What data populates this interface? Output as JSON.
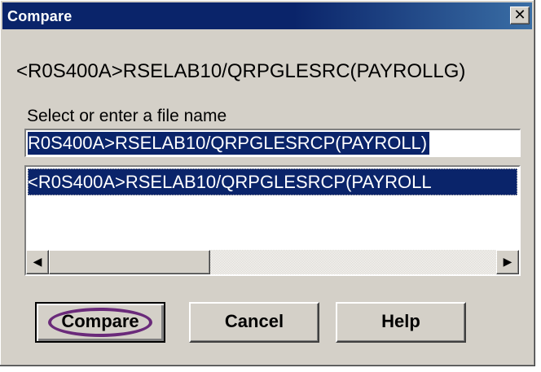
{
  "window": {
    "title": "Compare",
    "close_glyph": "✕"
  },
  "member_path": "<R0S400A>RSELAB10/QRPGLESRC(PAYROLLG)",
  "file_select": {
    "label": "Select or enter a file name",
    "input_value": "R0S400A>RSELAB10/QRPGLESRCP(PAYROLL)",
    "list_items": [
      "<R0S400A>RSELAB10/QRPGLESRCP(PAYROLL"
    ],
    "selected_index": 0
  },
  "scrollbar": {
    "left_arrow": "◀",
    "right_arrow": "▶"
  },
  "buttons": {
    "compare": "Compare",
    "cancel": "Cancel",
    "help": "Help"
  },
  "colors": {
    "titlebar": "#0a246a",
    "selection": "#0a246a",
    "dialog_bg": "#d4d0c8",
    "focus_ring": "#6a2a7a"
  }
}
